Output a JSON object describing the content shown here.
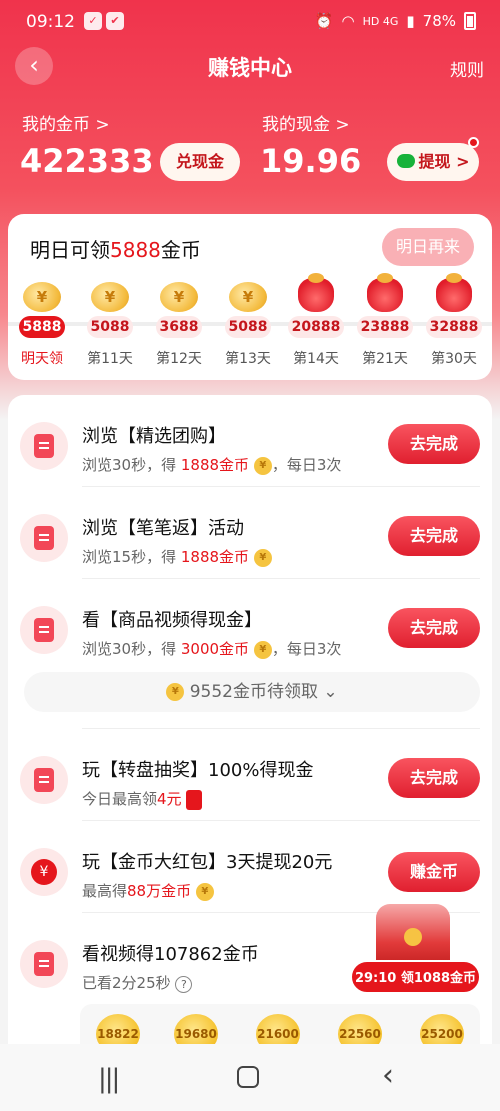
{
  "status": {
    "time": "09:12",
    "network": "HD 4G",
    "battery": "78%"
  },
  "header": {
    "title": "赚钱中心",
    "rules": "规则",
    "back_icon": "chevron-left-icon"
  },
  "balance": {
    "coins_label": "我的金币 >",
    "coins_value": "422333",
    "exchange_button": "兑现金",
    "cash_label": "我的现金 >",
    "cash_value": "19.96",
    "withdraw_button": "提现 >"
  },
  "checkin": {
    "title_prefix": "明日可领",
    "title_amount": "5888",
    "title_suffix": "金币",
    "come_back_button": "明日再来",
    "days": [
      {
        "amount": "5888",
        "label": "明天领",
        "icon": "coin-stack-icon"
      },
      {
        "amount": "5088",
        "label": "第11天",
        "icon": "coin-stack-icon"
      },
      {
        "amount": "3688",
        "label": "第12天",
        "icon": "coin-stack-icon"
      },
      {
        "amount": "5088",
        "label": "第13天",
        "icon": "coin-stack-icon"
      },
      {
        "amount": "20888",
        "label": "第14天",
        "icon": "money-bag-icon"
      },
      {
        "amount": "23888",
        "label": "第21天",
        "icon": "money-bag-icon"
      },
      {
        "amount": "32888",
        "label": "第30天",
        "icon": "money-bag-icon"
      }
    ]
  },
  "tasks": [
    {
      "title": "浏览【精选团购】",
      "sub_a": "浏览30秒，得 ",
      "sub_red": "1888金币",
      "sub_b": "，每日3次",
      "button": "去完成"
    },
    {
      "title": "浏览【笔笔返】活动",
      "sub_a": "浏览15秒，得 ",
      "sub_red": "1888金币",
      "sub_b": "",
      "button": "去完成"
    },
    {
      "title": "看【商品视频得现金】",
      "sub_a": "浏览30秒，得 ",
      "sub_red": "3000金币",
      "sub_b": "，每日3次",
      "button": "去完成"
    },
    {
      "title": "玩【转盘抽奖】100%得现金",
      "sub_a": "今日最高领",
      "sub_red": "4元",
      "sub_b": "",
      "button": "去完成"
    },
    {
      "title": "玩【金币大红包】3天提现20元",
      "sub_a": "最高得",
      "sub_red": "88万金币",
      "sub_b": "",
      "button": "赚金币"
    },
    {
      "title": "看视频得107862金币",
      "sub_a": "已看2分25秒",
      "sub_red": "",
      "sub_b": "",
      "button": ""
    }
  ],
  "pending": {
    "text": "9552金币待领取",
    "icon": "chevron-down-icon"
  },
  "video_rewards": [
    "18822",
    "19680",
    "21600",
    "22560",
    "25200"
  ],
  "floating": {
    "text": "29:10 领1088金币",
    "icon": "treasure-chest-icon"
  },
  "navbar": {
    "recent_icon": "recent-apps-icon",
    "home_icon": "home-icon",
    "back_icon": "back-icon"
  },
  "colors": {
    "accent": "#e5161c",
    "hero_top": "#f0334c"
  }
}
